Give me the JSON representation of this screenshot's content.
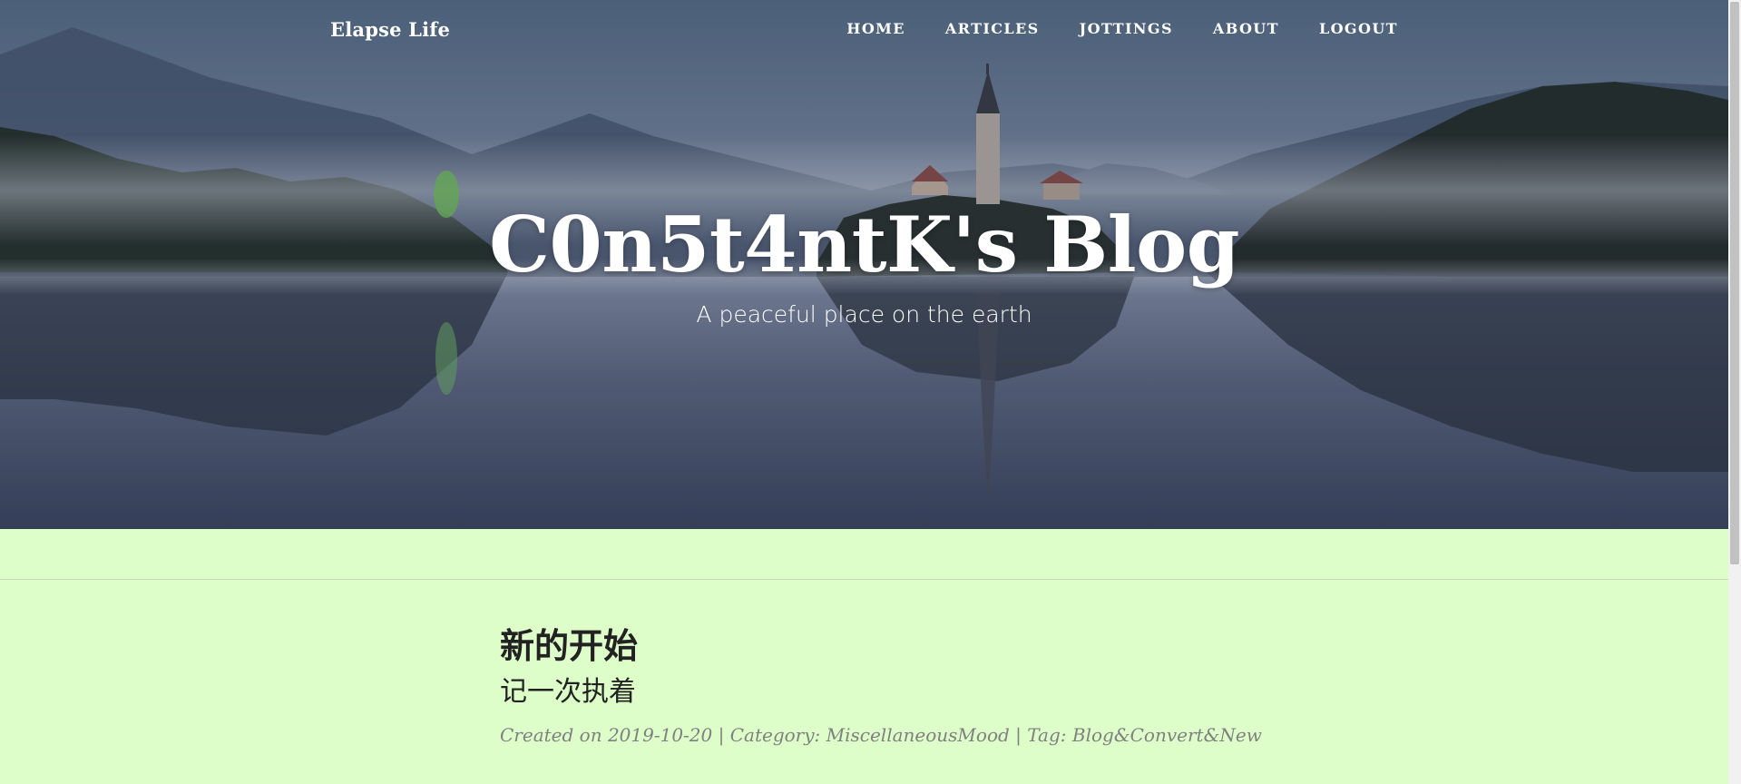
{
  "navbar": {
    "brand": "Elapse Life",
    "links": [
      "HOME",
      "ARTICLES",
      "JOTTINGS",
      "ABOUT",
      "LOGOUT"
    ]
  },
  "hero": {
    "title": "C0n5t4ntK's Blog",
    "subtitle": "A peaceful place on the earth"
  },
  "post": {
    "title": "新的开始",
    "subtitle": "记一次执着",
    "meta": {
      "created_label": "Created on",
      "date": "2019-10-20",
      "category_label": "Category:",
      "category": "MiscellaneousMood",
      "tag_label": "Tag:",
      "tag": "Blog&Convert&New",
      "separator": "|"
    }
  },
  "colors": {
    "page_background": "#ddfdc9",
    "text_dark": "#222222",
    "meta_gray": "#808080"
  }
}
